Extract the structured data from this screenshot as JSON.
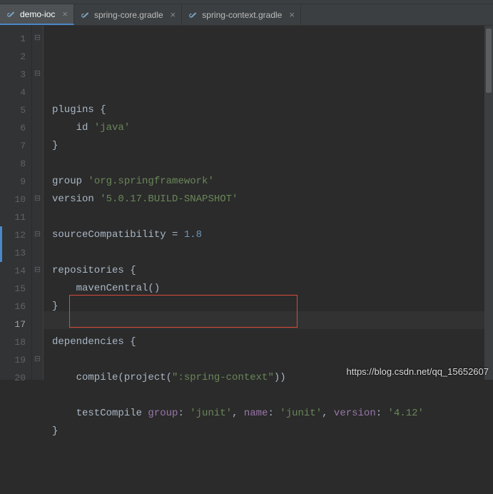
{
  "tabs": [
    {
      "label": "demo-ioc",
      "active": true
    },
    {
      "label": "spring-core.gradle",
      "active": false
    },
    {
      "label": "spring-context.gradle",
      "active": false
    }
  ],
  "gutter": {
    "start": 1,
    "end": 20,
    "current": 17
  },
  "fold": {
    "l1": "⊟",
    "l3": "⊟",
    "l10": "⊟",
    "l12": "⊟",
    "l14": "⊟",
    "l19": "⊟"
  },
  "code": {
    "l1": {
      "a": "plugins ",
      "b": "{"
    },
    "l2": {
      "a": "    id ",
      "b": "'java'"
    },
    "l3": {
      "a": "}"
    },
    "l5": {
      "a": "group ",
      "b": "'org.springframework'"
    },
    "l6": {
      "a": "version ",
      "b": "'5.0.17.BUILD-SNAPSHOT'"
    },
    "l8": {
      "a": "sourceCompatibility ",
      "b": "= ",
      "c": "1.8"
    },
    "l10": {
      "a": "repositories ",
      "b": "{"
    },
    "l11": {
      "a": "    mavenCentral()"
    },
    "l12": {
      "a": "}"
    },
    "l14": {
      "a": "dependencies ",
      "b": "{"
    },
    "l16": {
      "a": "    compile(project(",
      "b": "\":spring-context\"",
      "c": "))"
    },
    "l18": {
      "a": "    testCompile ",
      "g": "group",
      "c1": ": ",
      "s1": "'junit'",
      "c2": ", ",
      "n": "name",
      "c3": ": ",
      "s2": "'junit'",
      "c4": ", ",
      "v": "version",
      "c5": ": ",
      "s3": "'4.12'"
    },
    "l19": {
      "a": "}"
    }
  },
  "watermark": "https://blog.csdn.net/qq_15652607"
}
